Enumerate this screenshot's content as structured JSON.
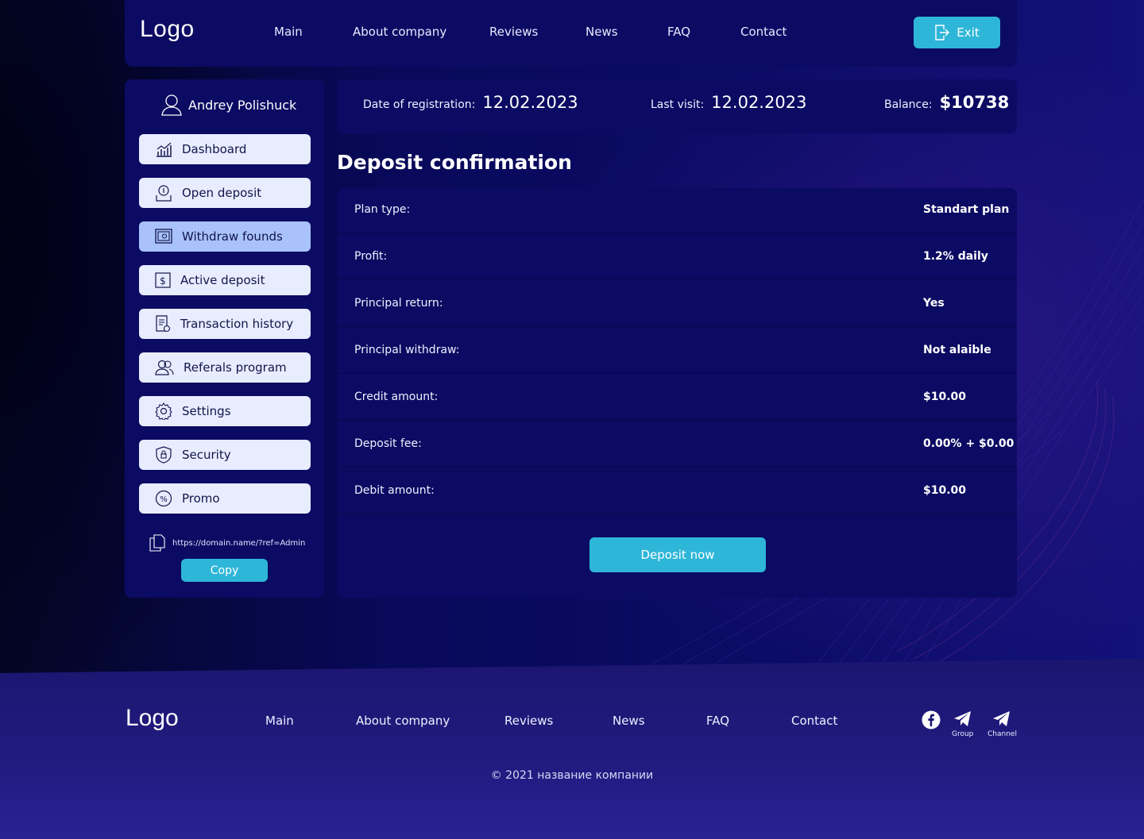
{
  "header": {
    "logo": "Logo",
    "nav": [
      "Main",
      "About company",
      "Reviews",
      "News",
      "FAQ",
      "Contact"
    ],
    "exit_label": "Exit"
  },
  "sidebar": {
    "user_name": "Andrey Polishuck",
    "items": [
      {
        "label": "Dashboard",
        "icon": "chart-icon"
      },
      {
        "label": "Open deposit",
        "icon": "deposit-icon"
      },
      {
        "label": "Withdraw founds",
        "icon": "safe-icon",
        "active": true
      },
      {
        "label": "Active deposit",
        "icon": "dollar-icon"
      },
      {
        "label": "Transaction history",
        "icon": "document-icon"
      },
      {
        "label": "Referals program",
        "icon": "users-icon"
      },
      {
        "label": "Settings",
        "icon": "gear-icon"
      },
      {
        "label": "Security",
        "icon": "shield-icon"
      },
      {
        "label": "Promo",
        "icon": "percent-icon"
      }
    ],
    "ref_link": "https://domain.name/?ref=Admin",
    "copy_label": "Copy"
  },
  "info": {
    "registration_label": "Date of registration:",
    "registration_value": "12.02.2023",
    "last_visit_label": "Last visit:",
    "last_visit_value": "12.02.2023",
    "balance_label": "Balance:",
    "balance_value": "$10738"
  },
  "page_title": "Deposit confirmation",
  "confirmation": {
    "rows": [
      {
        "label": "Plan type:",
        "value": "Standart plan"
      },
      {
        "label": "Profit:",
        "value": "1.2% daily"
      },
      {
        "label": "Principal return:",
        "value": "Yes"
      },
      {
        "label": "Principal withdraw:",
        "value": "Not alaible"
      },
      {
        "label": "Credit amount:",
        "value": "$10.00"
      },
      {
        "label": "Deposit fee:",
        "value": "0.00% + $0.00"
      },
      {
        "label": "Debit amount:",
        "value": "$10.00"
      }
    ],
    "button_label": "Deposit now"
  },
  "footer": {
    "logo": "Logo",
    "nav": [
      "Main",
      "About company",
      "Reviews",
      "News",
      "FAQ",
      "Contact"
    ],
    "social": [
      {
        "icon": "facebook-icon",
        "caption": ""
      },
      {
        "icon": "telegram-icon",
        "caption": "Group"
      },
      {
        "icon": "telegram-icon",
        "caption": "Channel"
      }
    ],
    "copyright": "© 2021 название компании"
  },
  "colors": {
    "accent": "#2eb6d8",
    "panel": "#0b0b63",
    "sidebar_item": "#e8ecff",
    "sidebar_item_active": "#a9c2fb"
  }
}
